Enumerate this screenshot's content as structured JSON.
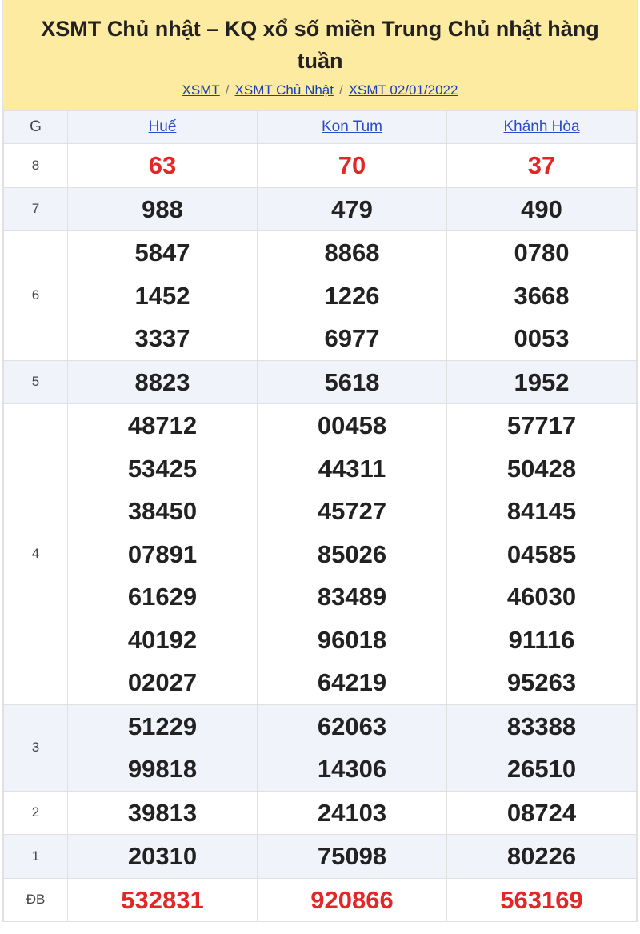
{
  "header": {
    "title": "XSMT Chủ nhật – KQ xổ số miền Trung Chủ nhật hàng tuần",
    "breadcrumb": [
      "XSMT",
      "XSMT Chủ Nhật",
      "XSMT 02/01/2022"
    ],
    "separator": "/"
  },
  "table": {
    "g_header": "G",
    "provinces": [
      "Huế",
      "Kon Tum",
      "Khánh Hòa"
    ],
    "rows": [
      {
        "label": "8",
        "highlight": true,
        "values": [
          [
            "63"
          ],
          [
            "70"
          ],
          [
            "37"
          ]
        ]
      },
      {
        "label": "7",
        "values": [
          [
            "988"
          ],
          [
            "479"
          ],
          [
            "490"
          ]
        ]
      },
      {
        "label": "6",
        "values": [
          [
            "5847",
            "1452",
            "3337"
          ],
          [
            "8868",
            "1226",
            "6977"
          ],
          [
            "0780",
            "3668",
            "0053"
          ]
        ]
      },
      {
        "label": "5",
        "values": [
          [
            "8823"
          ],
          [
            "5618"
          ],
          [
            "1952"
          ]
        ]
      },
      {
        "label": "4",
        "values": [
          [
            "48712",
            "53425",
            "38450",
            "07891",
            "61629",
            "40192",
            "02027"
          ],
          [
            "00458",
            "44311",
            "45727",
            "85026",
            "83489",
            "96018",
            "64219"
          ],
          [
            "57717",
            "50428",
            "84145",
            "04585",
            "46030",
            "91116",
            "95263"
          ]
        ]
      },
      {
        "label": "3",
        "values": [
          [
            "51229",
            "99818"
          ],
          [
            "62063",
            "14306"
          ],
          [
            "83388",
            "26510"
          ]
        ]
      },
      {
        "label": "2",
        "values": [
          [
            "39813"
          ],
          [
            "24103"
          ],
          [
            "08724"
          ]
        ]
      },
      {
        "label": "1",
        "values": [
          [
            "20310"
          ],
          [
            "75098"
          ],
          [
            "80226"
          ]
        ]
      },
      {
        "label": "ĐB",
        "highlight": true,
        "values": [
          [
            "532831"
          ],
          [
            "920866"
          ],
          [
            "563169"
          ]
        ]
      }
    ]
  },
  "colors": {
    "header_bg": "#fdeba1",
    "highlight_red": "#e32626",
    "link_blue": "#2b4cc7",
    "alt_row_bg": "#f0f4fa"
  }
}
